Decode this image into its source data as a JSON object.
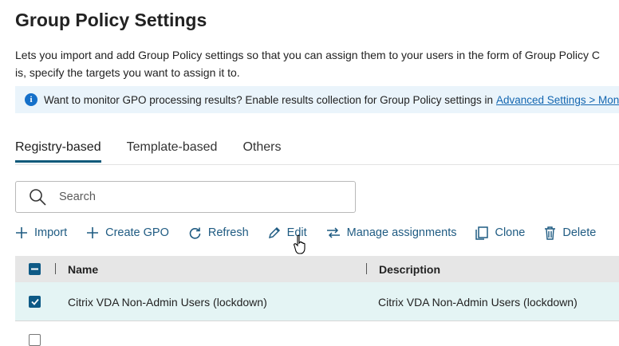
{
  "page": {
    "title": "Group Policy Settings",
    "description_line1": "Lets you import and add Group Policy settings so that you can assign them to your users in the form of Group Policy C",
    "description_line2": "is, specify the targets you want to assign it to."
  },
  "info_banner": {
    "text": "Want to monitor GPO processing results? Enable results collection for Group Policy settings in",
    "link": "Advanced Settings > Mon",
    "icon": "info-icon"
  },
  "tabs": [
    {
      "label": "Registry-based",
      "active": true
    },
    {
      "label": "Template-based",
      "active": false
    },
    {
      "label": "Others",
      "active": false
    }
  ],
  "search": {
    "placeholder": "Search",
    "value": ""
  },
  "toolbar": {
    "import": "Import",
    "create_gpo": "Create GPO",
    "refresh": "Refresh",
    "edit": "Edit",
    "manage_assignments": "Manage assignments",
    "clone": "Clone",
    "delete": "Delete"
  },
  "table": {
    "columns": [
      "Name",
      "Description"
    ],
    "rows": [
      {
        "name": "Citrix VDA Non-Admin Users (lockdown)",
        "description": "Citrix VDA Non-Admin Users (lockdown)",
        "selected": true
      }
    ]
  },
  "colors": {
    "accent": "#0f5a7a",
    "toolbar_text": "#1f5b82",
    "banner_bg": "#eaf4fb",
    "selected_row_bg": "#e4f4f4",
    "header_bg": "#e6e6e6"
  }
}
